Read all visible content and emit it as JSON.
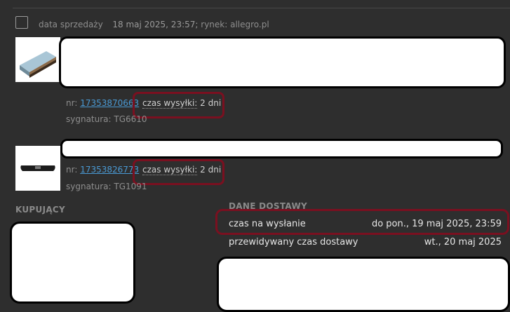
{
  "sale": {
    "label": "data sprzedaży",
    "date": "18 maj 2025, 23:57;",
    "market": "rynek: allegro.pl"
  },
  "items": [
    {
      "nr_label": "nr:",
      "nr_value": "17353870663",
      "ship_label": "czas wysyłki:",
      "ship_value": "2 dni",
      "sig": "sygnatura: TG6610"
    },
    {
      "nr_label": "nr:",
      "nr_value": "17353826773",
      "ship_label": "czas wysyłki:",
      "ship_value": "2 dni",
      "sig": "sygnatura: TG1091"
    }
  ],
  "buyer": {
    "title": "KUPUJĄCY"
  },
  "delivery": {
    "title": "DANE DOSTAWY",
    "rows": [
      {
        "label": "czas na wysłanie",
        "value": "do pon., 19 maj 2025, 23:59"
      },
      {
        "label": "przewidywany czas dostawy",
        "value": "wt., 20 maj 2025"
      }
    ]
  },
  "colors": {
    "background": "#2e2e2e",
    "link": "#4a9ad4",
    "highlight": "#7a1020"
  }
}
